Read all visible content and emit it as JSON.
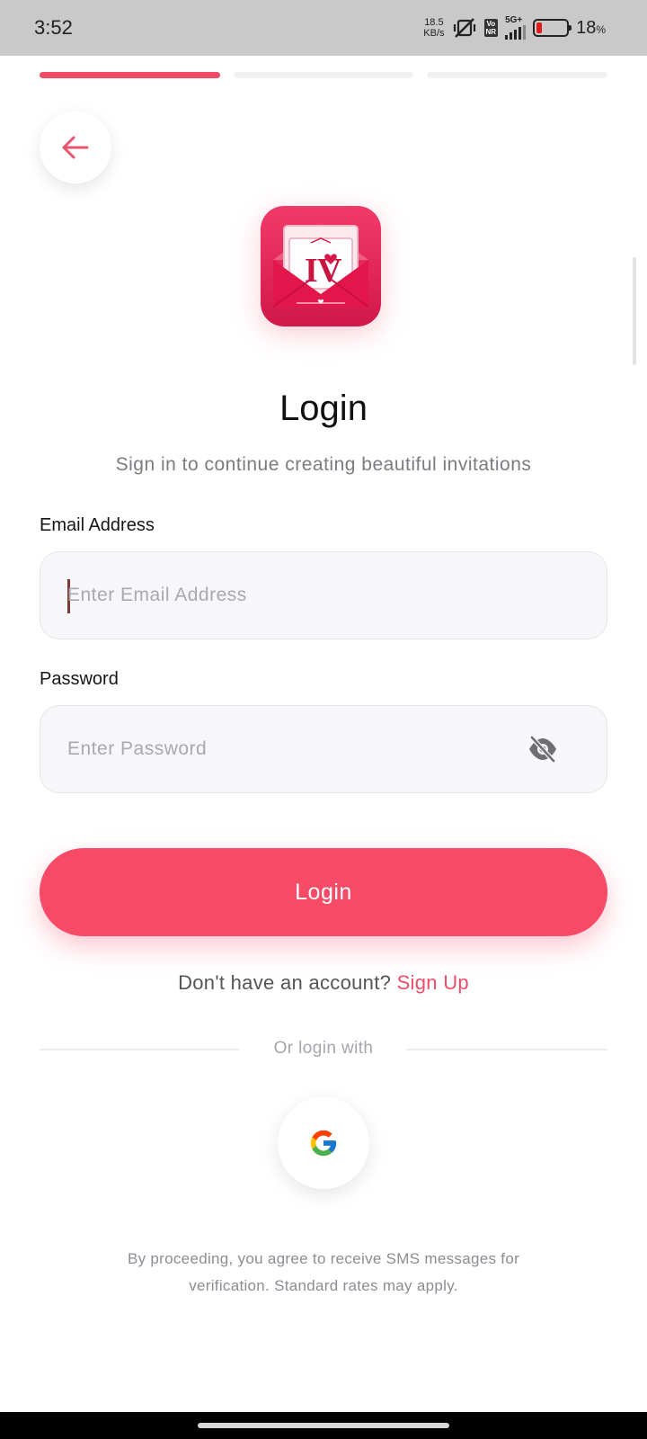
{
  "status_bar": {
    "time": "3:52",
    "net_speed_value": "18.5",
    "net_speed_unit": "KB/s",
    "volte_top": "Vo",
    "volte_bottom": "NR",
    "network_type": "5G+",
    "battery_percent": "18",
    "battery_percent_sign": "%",
    "battery_level": 0.18,
    "battery_color": "#e01b1b"
  },
  "progress": {
    "total_steps": 3,
    "active_step": 1,
    "active_color": "#f24b67"
  },
  "header": {
    "back_icon": "arrow-left-icon"
  },
  "logo": {
    "text": "IV",
    "icon": "invitation-envelope-logo"
  },
  "title": "Login",
  "subtitle": "Sign in to continue creating beautiful invitations",
  "form": {
    "email": {
      "label": "Email Address",
      "placeholder": "Enter Email Address",
      "value": ""
    },
    "password": {
      "label": "Password",
      "placeholder": "Enter Password",
      "value": "",
      "toggle_icon": "eye-off-icon"
    },
    "login_button": "Login"
  },
  "signup": {
    "prompt": "Don't have an account?",
    "link": "Sign Up"
  },
  "social": {
    "divider_text": "Or login with",
    "google_icon": "google-icon"
  },
  "footer": {
    "line1": "By proceeding, you agree to receive SMS messages for",
    "line2": "verification. Standard rates may apply."
  },
  "colors": {
    "accent": "#f64a67",
    "field_bg": "#f7f7f9",
    "muted_text": "#7b7b80"
  }
}
